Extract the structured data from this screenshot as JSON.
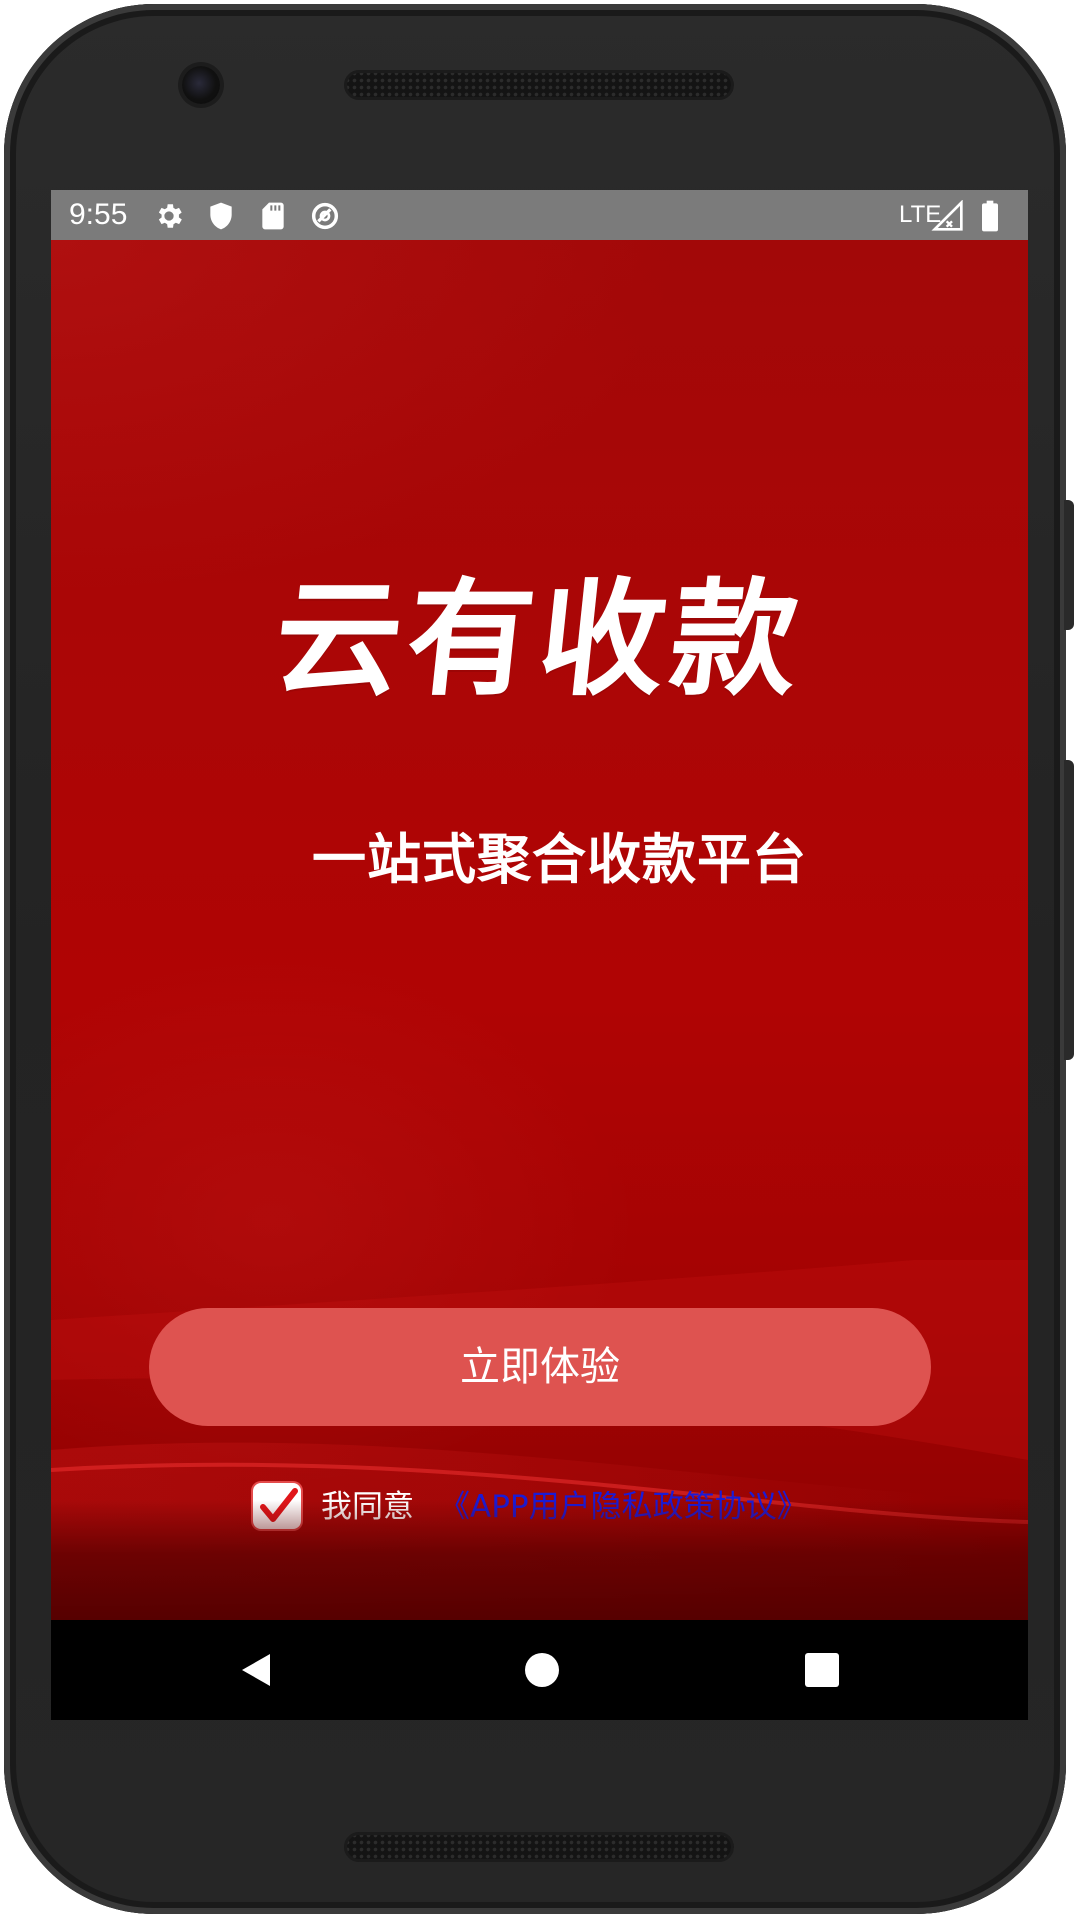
{
  "status_bar": {
    "time": "9:55",
    "network": "LTE",
    "left_icons": [
      "gear-icon",
      "shield-icon",
      "sd-card-icon",
      "data-saver-icon"
    ],
    "right_icons": [
      "signal-icon",
      "battery-icon"
    ]
  },
  "app": {
    "title": "云有收款",
    "subtitle": "一站式聚合收款平台",
    "cta_label": "立即体验",
    "agreement": {
      "checked": true,
      "prefix": "我同意",
      "link_text": "《APP用户隐私政策协议》"
    }
  },
  "nav_bar": {
    "buttons": [
      "back-icon",
      "home-icon",
      "recents-icon"
    ]
  },
  "colors": {
    "background_red": "#ab0606",
    "button": "#de5350",
    "link": "#1b1bd6",
    "checkmark": "#e0161a",
    "status_bar": "#7b7b7b"
  }
}
